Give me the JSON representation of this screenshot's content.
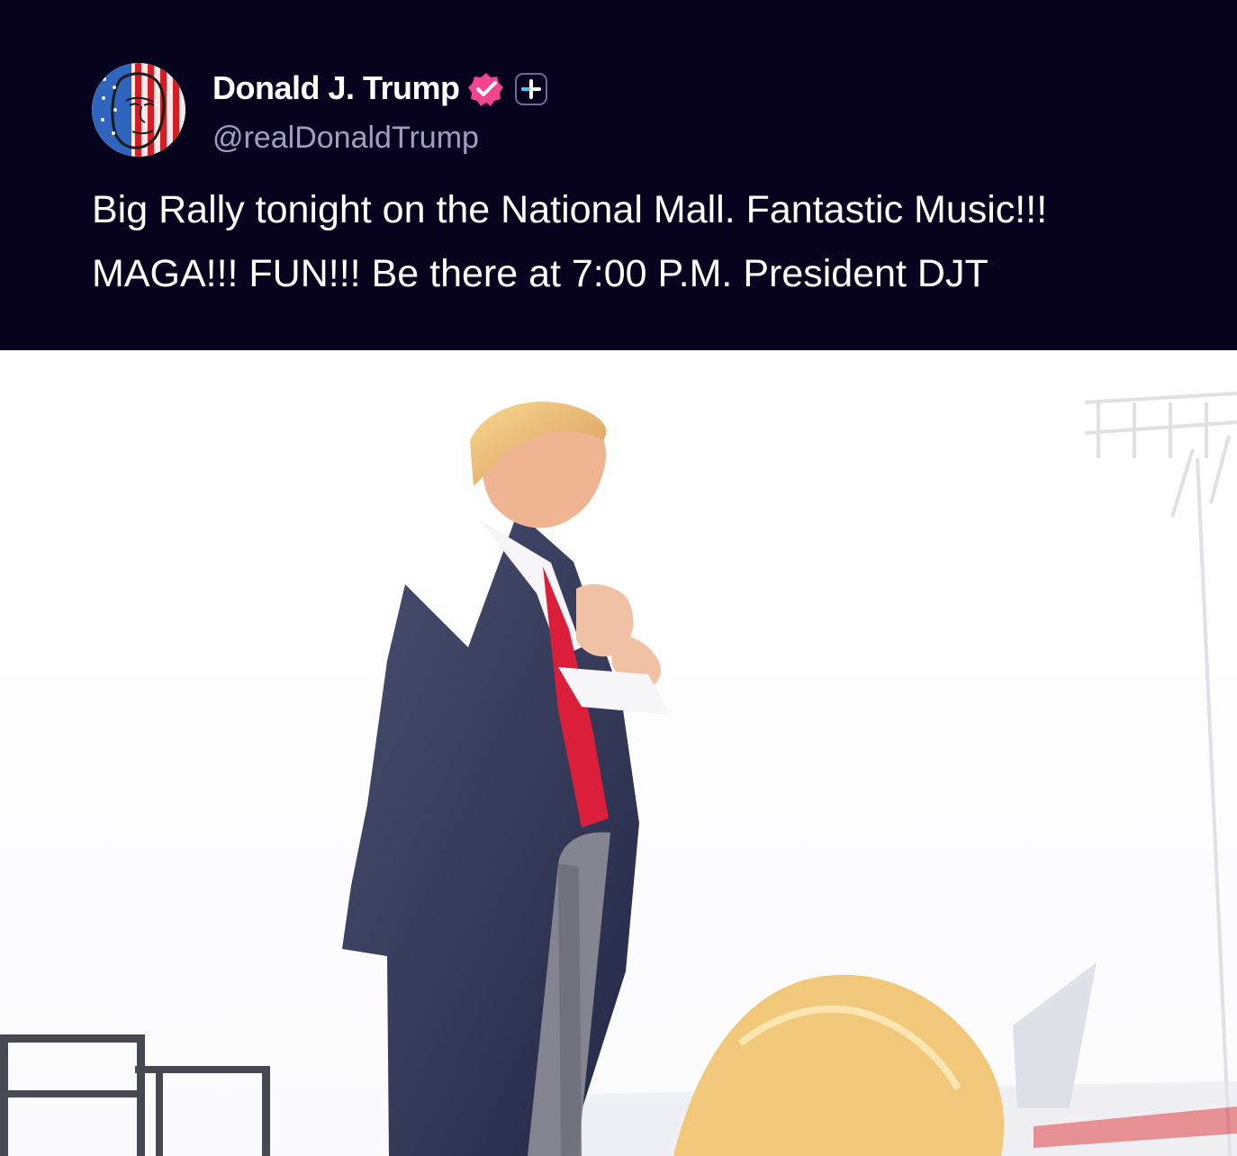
{
  "post": {
    "author": {
      "display_name": "Donald J. Trump",
      "handle": "@realDonaldTrump",
      "avatar_icon": "flag-portrait-avatar",
      "verified_icon": "verified-badge-icon",
      "plus_icon": "plus-badge-icon"
    },
    "text": "Big Rally tonight on the National Mall. Fantastic Music!!! MAGA!!! FUN!!! Be there at 7:00 P.M. President DJT",
    "media": {
      "type": "video-still",
      "description_icon": "rally-video-frame"
    }
  },
  "colors": {
    "header_background": "#07031f",
    "handle": "#a39dc2",
    "verified_badge": "#f2448f",
    "plus_badge_border": "#6e6a94",
    "text": "#ffffff"
  }
}
